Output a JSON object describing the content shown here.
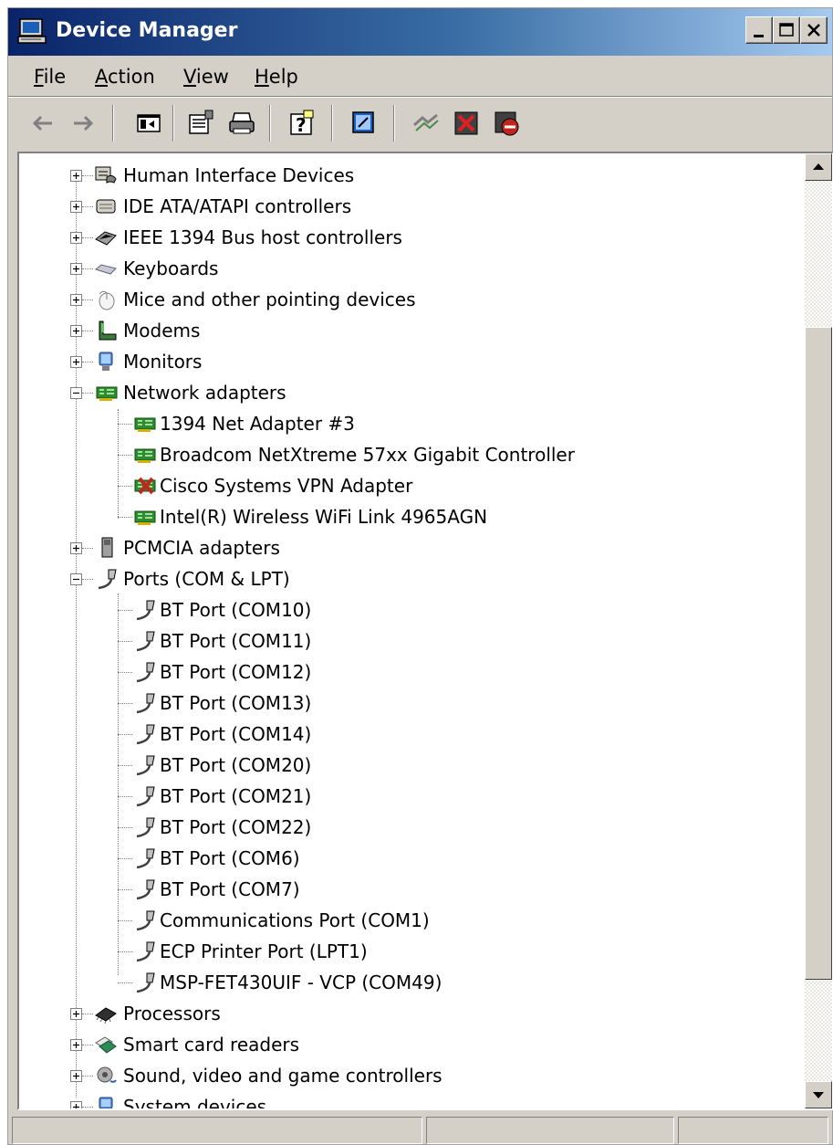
{
  "window": {
    "title": "Device Manager"
  },
  "menu": {
    "file": "File",
    "action": "Action",
    "view": "View",
    "help": "Help",
    "file_key": "F",
    "action_key": "A",
    "view_key": "V",
    "help_key": "H"
  },
  "toolbar": {
    "buttons": [
      "back-icon",
      "forward-icon",
      "show-hide-console-tree-icon",
      "properties-icon",
      "print-icon",
      "help-icon",
      "scan-hardware-icon",
      "update-driver-icon",
      "uninstall-icon",
      "disable-icon"
    ]
  },
  "tree": {
    "hid": "Human Interface Devices",
    "ide": "IDE ATA/ATAPI controllers",
    "ieee": "IEEE 1394 Bus host controllers",
    "keyboards": "Keyboards",
    "mice": "Mice and other pointing devices",
    "modems": "Modems",
    "monitors": "Monitors",
    "network": "Network adapters",
    "net_children": [
      "1394 Net Adapter #3",
      "Broadcom NetXtreme 57xx Gigabit Controller",
      "Cisco Systems VPN Adapter",
      "Intel(R) Wireless WiFi Link 4965AGN"
    ],
    "pcmcia": "PCMCIA adapters",
    "ports": "Ports (COM & LPT)",
    "port_children": [
      "BT Port (COM10)",
      "BT Port (COM11)",
      "BT Port (COM12)",
      "BT Port (COM13)",
      "BT Port (COM14)",
      "BT Port (COM20)",
      "BT Port (COM21)",
      "BT Port (COM22)",
      "BT Port (COM6)",
      "BT Port (COM7)",
      "Communications Port (COM1)",
      "ECP Printer Port (LPT1)",
      "MSP-FET430UIF - VCP (COM49)"
    ],
    "processors": "Processors",
    "smartcard": "Smart card readers",
    "sound": "Sound, video and game controllers",
    "system": "System devices"
  },
  "status": {
    "panel1": "",
    "panel2": "",
    "panel3": ""
  },
  "colors": {
    "titlebar_start": "#0a246a",
    "titlebar_end": "#a6caf0",
    "chrome": "#d4d0c8",
    "network_icon": "#2e8b2e",
    "disabled_icon": "#c0261e"
  }
}
